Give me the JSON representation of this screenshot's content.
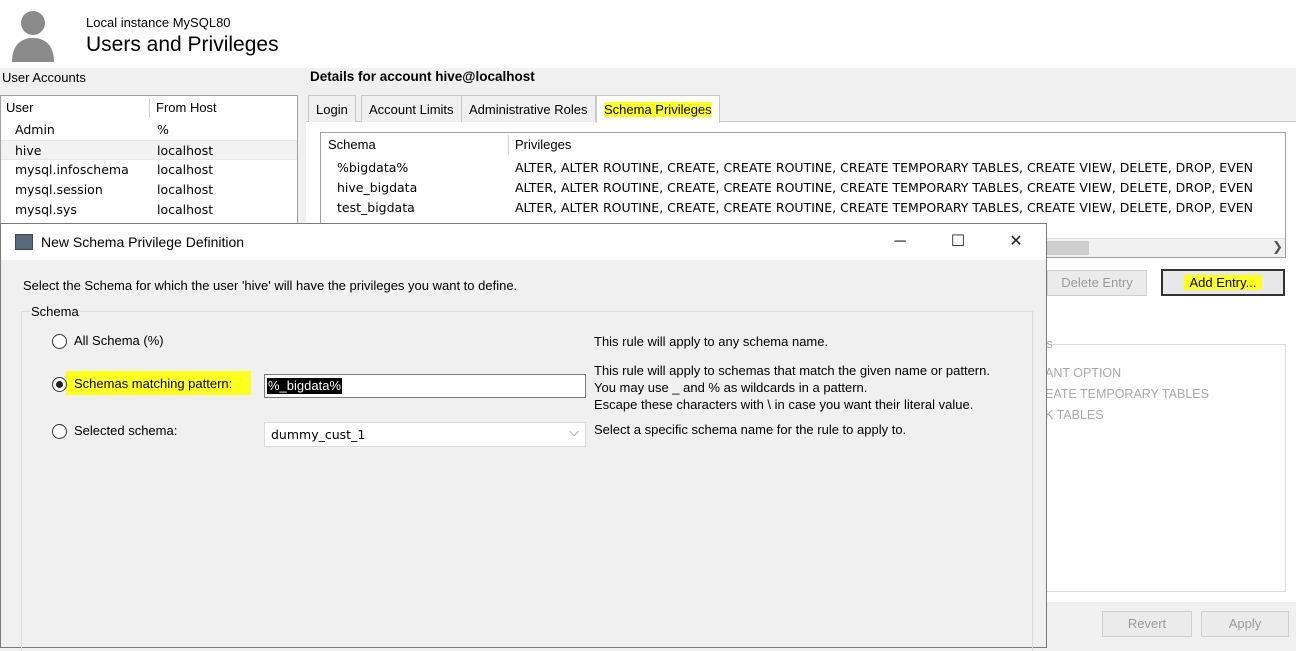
{
  "header": {
    "instance": "Local instance MySQL80",
    "title": "Users and Privileges",
    "avatar_icon": "user-silhouette-icon"
  },
  "user_accounts": {
    "label": "User Accounts",
    "columns": [
      "User",
      "From Host"
    ],
    "rows": [
      {
        "user": "Admin",
        "host": "%"
      },
      {
        "user": "hive",
        "host": "localhost"
      },
      {
        "user": "mysql.infoschema",
        "host": "localhost"
      },
      {
        "user": "mysql.session",
        "host": "localhost"
      },
      {
        "user": "mysql.sys",
        "host": "localhost"
      }
    ]
  },
  "details": {
    "title": "Details for account hive@localhost",
    "tabs": [
      "Login",
      "Account Limits",
      "Administrative Roles",
      "Schema Privileges"
    ],
    "active_tab": "Schema Privileges",
    "privileges_table": {
      "columns": [
        "Schema",
        "Privileges"
      ],
      "rows": [
        {
          "schema": "%bigdata%",
          "privileges": "ALTER, ALTER ROUTINE, CREATE, CREATE ROUTINE, CREATE TEMPORARY TABLES, CREATE VIEW, DELETE, DROP, EVEN"
        },
        {
          "schema": "hive_bigdata",
          "privileges": "ALTER, ALTER ROUTINE, CREATE, CREATE ROUTINE, CREATE TEMPORARY TABLES, CREATE VIEW, DELETE, DROP, EVEN"
        },
        {
          "schema": "test_bigdata",
          "privileges": "ALTER, ALTER ROUTINE, CREATE, CREATE ROUTINE, CREATE TEMPORARY TABLES, CREATE VIEW, DELETE, DROP, EVEN"
        }
      ]
    },
    "buttons": {
      "delete_entry": "Delete Entry",
      "add_entry": "Add Entry..."
    },
    "background_privs": {
      "header_fragment": "ts",
      "items": [
        "ANT OPTION",
        "EATE TEMPORARY TABLES",
        "K TABLES"
      ]
    },
    "footer": {
      "revert": "Revert",
      "apply": "Apply"
    }
  },
  "dialog": {
    "title": "New Schema Privilege Definition",
    "intro": "Select the Schema for which the user 'hive' will have the privileges you want to define.",
    "group_label": "Schema",
    "options": {
      "all": {
        "label": "All Schema (%)",
        "desc": "This rule will apply to any schema name."
      },
      "pattern": {
        "label": "Schemas matching pattern:",
        "value": "%_bigdata%",
        "desc1": "This rule will apply to schemas that match the given name or pattern.",
        "desc2": "You may use _ and % as wildcards in a pattern.",
        "desc3": "Escape these characters with \\ in case you want their literal value."
      },
      "selected": {
        "label": "Selected schema:",
        "value": "dummy_cust_1",
        "desc": "Select a specific schema name for the rule to apply to."
      }
    },
    "selected_option": "pattern",
    "highlight_color": "#ffff1e"
  }
}
